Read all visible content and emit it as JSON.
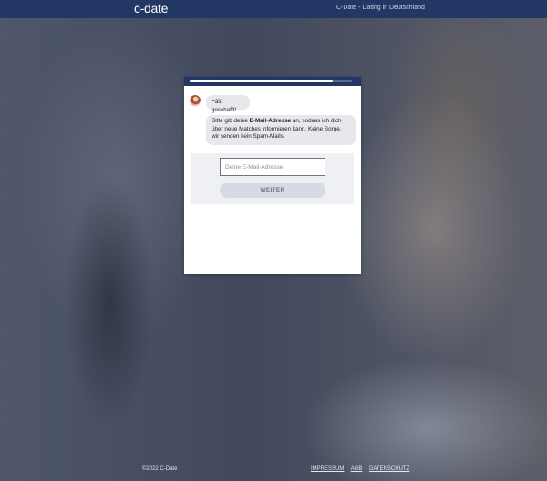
{
  "header": {
    "logo": "c-date",
    "tagline": "C-Date - Dating in Deutschland",
    "color": "#223763"
  },
  "progress": {
    "fraction": 0.88
  },
  "chat": {
    "message_1": "Fast geschafft!",
    "message_2_before": "Bitte gib deine ",
    "message_2_bold": "E-Mail-Adresse",
    "message_2_after": " an, sodass ich dich über neue Matches informieren kann. Keine Sorge, wir senden kein Spam-Mails.",
    "avatar_icon": "woman-avatar-icon"
  },
  "form": {
    "email_value": "",
    "email_placeholder": "Deine E-Mail-Adresse",
    "submit_label": "WEITER"
  },
  "footer": {
    "copyright": "©2022 C-Date",
    "links": [
      "IMPRESSUM",
      "AGB",
      "DATENSCHUTZ"
    ]
  }
}
